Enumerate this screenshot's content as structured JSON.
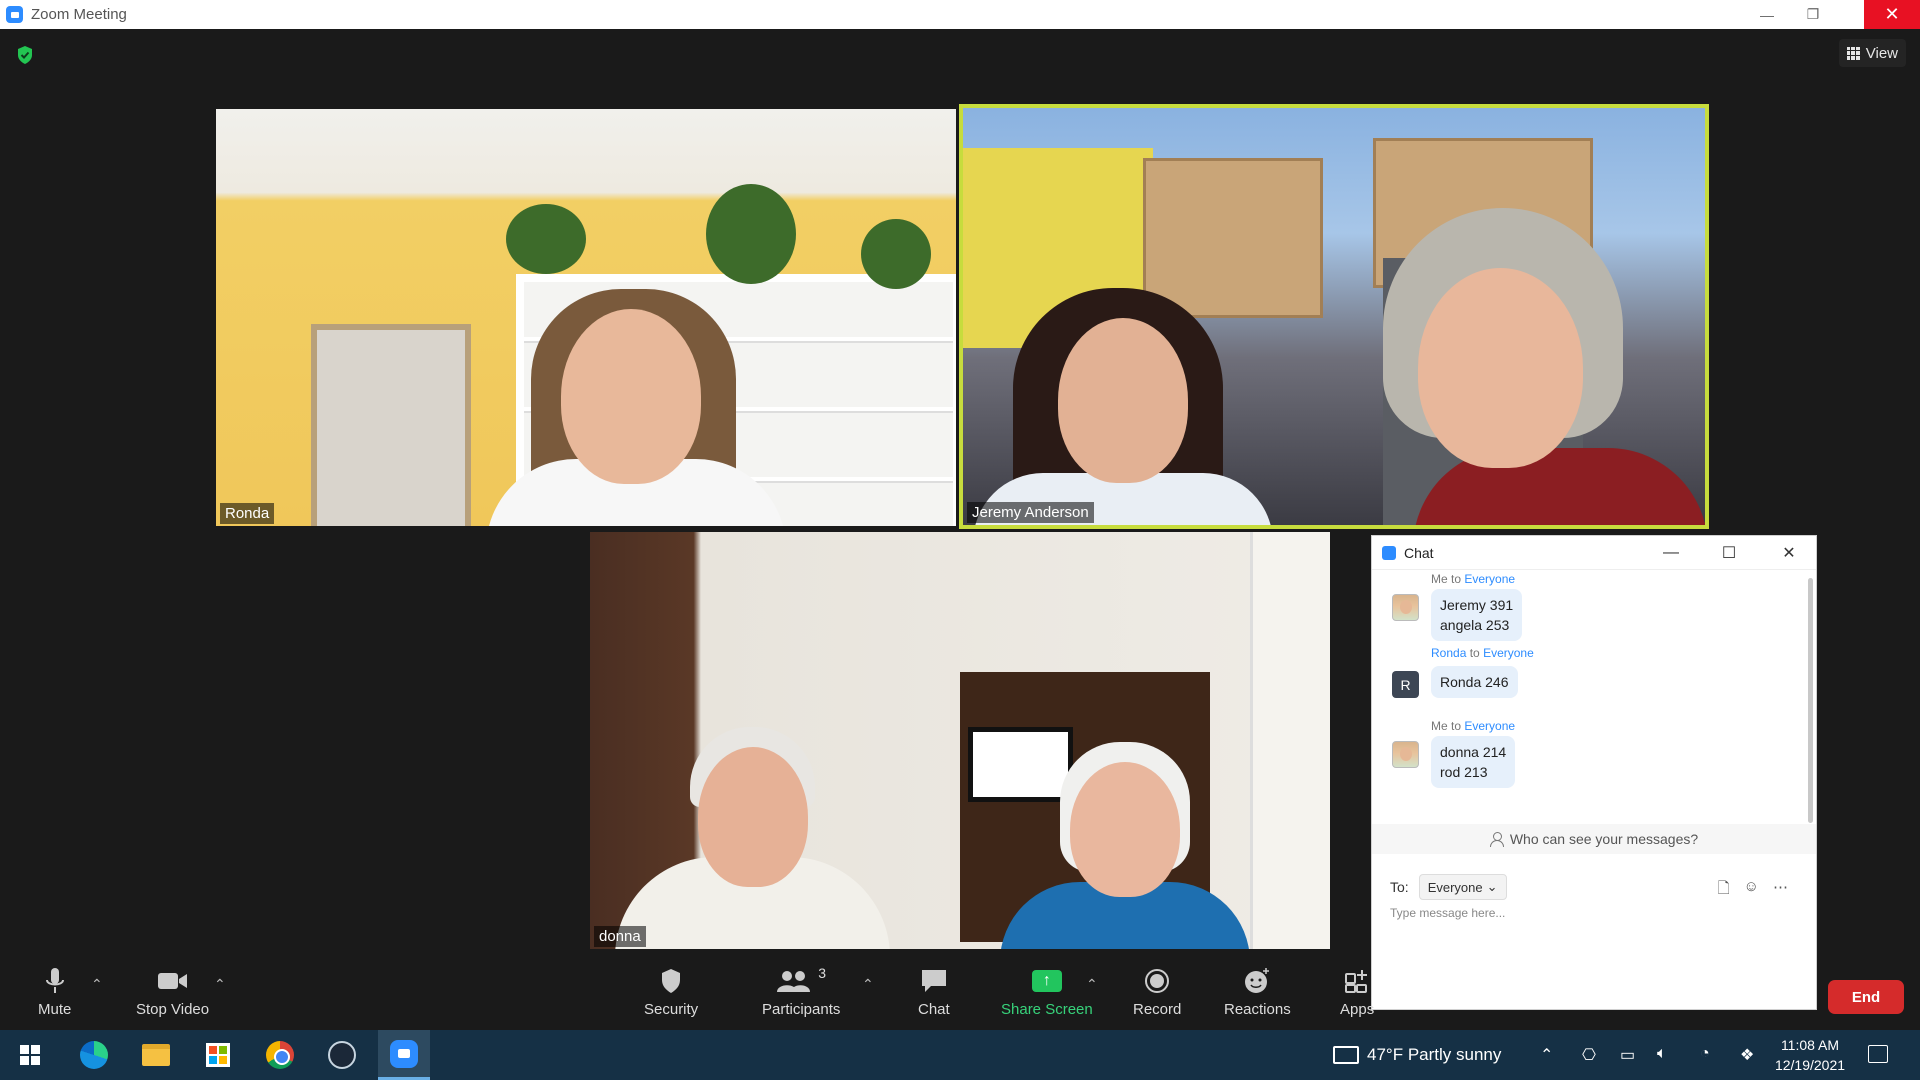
{
  "window": {
    "title": "Zoom Meeting",
    "minimize": "—",
    "restore": "❐",
    "close": "✕"
  },
  "meeting": {
    "view_label": "View",
    "tiles": [
      {
        "name": "Ronda"
      },
      {
        "name": "Jeremy Anderson",
        "active_speaker": true
      },
      {
        "name": "donna"
      }
    ]
  },
  "chat": {
    "title": "Chat",
    "messages": [
      {
        "from": "Me",
        "to_word": "to",
        "to": "Everyone",
        "lines": [
          "Jeremy 391",
          "angela 253"
        ]
      },
      {
        "from": "Ronda",
        "avatar_letter": "R",
        "to_word": "to",
        "to": "Everyone",
        "lines": [
          "Ronda 246"
        ]
      },
      {
        "from": "Me",
        "to_word": "to",
        "to": "Everyone",
        "lines": [
          "donna 214",
          "rod 213"
        ]
      }
    ],
    "who_can_see": "Who can see your messages?",
    "to_label": "To:",
    "recipient": "Everyone",
    "placeholder": "Type message here..."
  },
  "toolbar": {
    "mute": "Mute",
    "stop_video": "Stop Video",
    "security": "Security",
    "participants": "Participants",
    "participants_count": "3",
    "chat": "Chat",
    "share_screen": "Share Screen",
    "record": "Record",
    "reactions": "Reactions",
    "apps": "Apps",
    "end": "End"
  },
  "taskbar": {
    "weather": "47°F  Partly sunny",
    "time": "11:08 AM",
    "date": "12/19/2021"
  },
  "colors": {
    "active_speaker_border": "#c7dc3d",
    "end_button": "#d52b2b",
    "share_screen": "#22c55e",
    "zoom_blue": "#2d8cff"
  }
}
